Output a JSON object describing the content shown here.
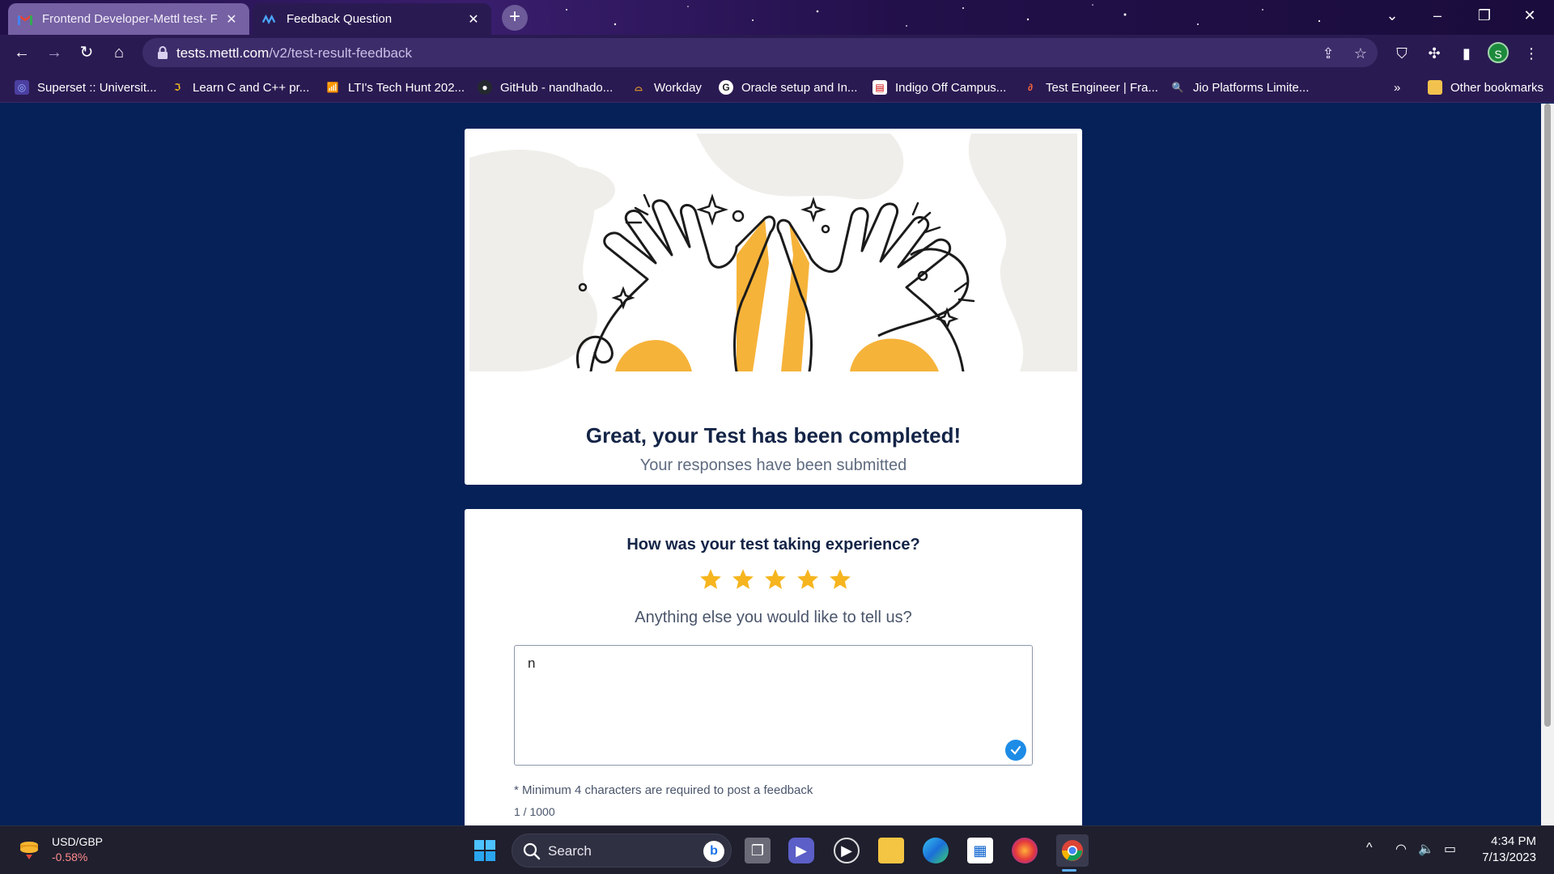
{
  "browser": {
    "tabs": [
      {
        "title": "Frontend Developer-Mettl test- F",
        "active": false
      },
      {
        "title": "Feedback Question",
        "active": true
      }
    ],
    "new_tab": "+",
    "url_host": "tests.mettl.com",
    "url_path": "/v2/test-result-feedback",
    "profile_initial": "S"
  },
  "bookmarks": {
    "items": [
      "Superset :: Universit...",
      "Learn C and C++ pr...",
      "LTI's Tech Hunt 202...",
      "GitHub - nandhado...",
      "Workday",
      "Oracle setup and In...",
      "Indigo Off Campus...",
      "Test Engineer | Fra...",
      "Jio Platforms Limite..."
    ],
    "overflow": "»",
    "other": "Other bookmarks"
  },
  "completion": {
    "title": "Great, your Test has been completed!",
    "subtitle": "Your responses have been submitted"
  },
  "feedback": {
    "question": "How was your test taking experience?",
    "rating": 5,
    "rating_max": 5,
    "comment_prompt": "Anything else you would like to tell us?",
    "comment_value": "n",
    "hint": "* Minimum 4 characters are required to post a feedback",
    "counter": "1 / 1000"
  },
  "taskbar": {
    "ticker_symbol": "USD/GBP",
    "ticker_change": "-0.58%",
    "search_label": "Search",
    "time": "4:34 PM",
    "date": "7/13/2023"
  },
  "colors": {
    "page_bg": "#062158",
    "star": "#f6b51e",
    "accent": "#1d8ce6"
  }
}
